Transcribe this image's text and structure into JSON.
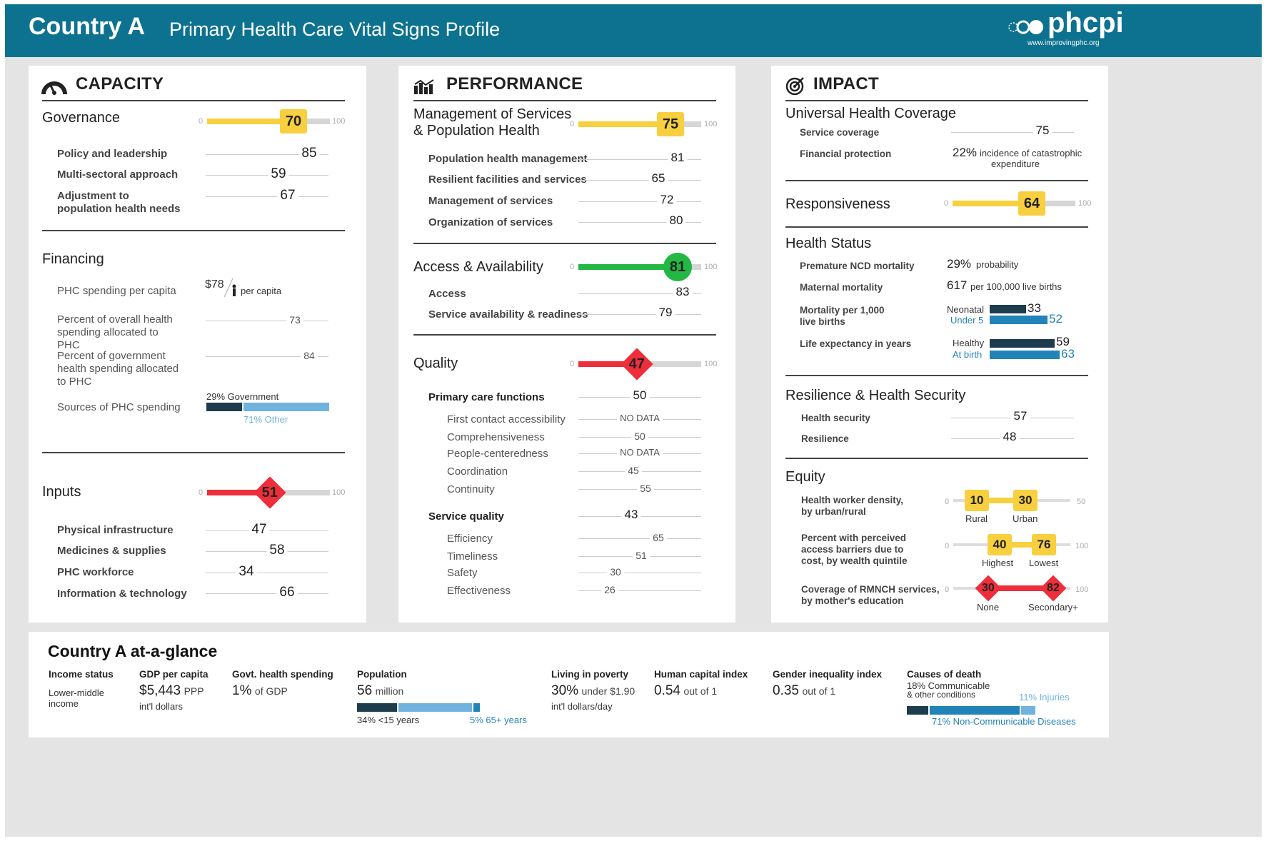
{
  "header": {
    "country": "Country A",
    "subtitle": "Primary Health Care Vital Signs Profile",
    "logo_text": "phcpi",
    "logo_url": "www.improvingphc.org"
  },
  "colors": {
    "header": "#0d7290",
    "yellow": "#f8cf3e",
    "green": "#22b843",
    "red": "#ee2e3a",
    "dark": "#1d3c4e",
    "light_blue": "#6fb3de",
    "mid_blue": "#2283b8",
    "track": "#d6d6d6"
  },
  "capacity": {
    "title": "CAPACITY",
    "icon": "gauge-icon",
    "governance": {
      "label": "Governance",
      "score": "70",
      "value": 70,
      "min": "0",
      "max": "100",
      "items": [
        {
          "label": "Policy and leadership",
          "value": "85"
        },
        {
          "label": "Multi-sectoral approach",
          "value": "59"
        },
        {
          "label": "Adjustment to population health needs",
          "value": "67"
        }
      ]
    },
    "financing": {
      "label": "Financing",
      "spending_label": "PHC spending per capita",
      "spending_value": "$78",
      "spending_unit": "per capita",
      "overall_label": "Percent of overall health spending allocated to PHC",
      "overall_value": "73",
      "gov_label": "Percent of government health spending allocated to PHC",
      "gov_value": "84",
      "sources_label": "Sources of PHC spending",
      "gov_pct": "29%",
      "gov_name": "Government",
      "other_pct": "71%",
      "other_name": "Other",
      "gov_share": 29
    },
    "inputs": {
      "label": "Inputs",
      "score": "51",
      "value": 51,
      "min": "0",
      "max": "100",
      "items": [
        {
          "label": "Physical infrastructure",
          "value": "47"
        },
        {
          "label": "Medicines & supplies",
          "value": "58"
        },
        {
          "label": "PHC workforce",
          "value": "34"
        },
        {
          "label": "Information & technology",
          "value": "66"
        }
      ]
    }
  },
  "performance": {
    "title": "PERFORMANCE",
    "icon": "chart-icon",
    "management": {
      "label1": "Management of Services",
      "label2": "& Population Health",
      "score": "75",
      "value": 75,
      "min": "0",
      "max": "100",
      "items": [
        {
          "label": "Population health management",
          "value": "81"
        },
        {
          "label": "Resilient facilities and services",
          "value": "65"
        },
        {
          "label": "Management of services",
          "value": "72"
        },
        {
          "label": "Organization of services",
          "value": "80"
        }
      ]
    },
    "access": {
      "label": "Access & Availability",
      "score": "81",
      "value": 81,
      "min": "0",
      "max": "100",
      "items": [
        {
          "label": "Access",
          "value": "83"
        },
        {
          "label": "Service availability & readiness",
          "value": "79"
        }
      ]
    },
    "quality": {
      "label": "Quality",
      "score": "47",
      "value": 47,
      "min": "0",
      "max": "100",
      "pcf_label": "Primary care functions",
      "pcf_value": "50",
      "pcf_items": [
        {
          "label": "First contact accessibility",
          "value": "NO DATA"
        },
        {
          "label": "Comprehensiveness",
          "value": "50"
        },
        {
          "label": "People-centeredness",
          "value": "NO DATA"
        },
        {
          "label": "Coordination",
          "value": "45"
        },
        {
          "label": "Continuity",
          "value": "55"
        }
      ],
      "sq_label": "Service quality",
      "sq_value": "43",
      "sq_items": [
        {
          "label": "Efficiency",
          "value": "65"
        },
        {
          "label": "Timeliness",
          "value": "51"
        },
        {
          "label": "Safety",
          "value": "30"
        },
        {
          "label": "Effectiveness",
          "value": "26"
        }
      ]
    }
  },
  "impact": {
    "title": "IMPACT",
    "icon": "target-icon",
    "uhc": {
      "label": "Universal Health Coverage",
      "coverage_label": "Service coverage",
      "coverage_value": "75",
      "fin_label": "Financial protection",
      "fin_pct": "22%",
      "fin_text1": "incidence of catastrophic",
      "fin_text2": "expenditure"
    },
    "responsiveness": {
      "label": "Responsiveness",
      "score": "64",
      "value": 64,
      "min": "0",
      "max": "100"
    },
    "health_status": {
      "label": "Health Status",
      "ncd_label": "Premature NCD mortality",
      "ncd_value": "29%",
      "ncd_unit": "probability",
      "mat_label": "Maternal mortality",
      "mat_value": "617",
      "mat_unit": "per 100,000 live births",
      "mort_label1": "Mortality per 1,000",
      "mort_label2": "live births",
      "neonatal_label": "Neonatal",
      "neonatal_value": "33",
      "neonatal_num": 33,
      "under5_label": "Under 5",
      "under5_value": "52",
      "under5_num": 52,
      "life_label": "Life expectancy in years",
      "healthy_label": "Healthy",
      "healthy_value": "59",
      "healthy_num": 59,
      "birth_label": "At birth",
      "birth_value": "63",
      "birth_num": 63
    },
    "resilience": {
      "label": "Resilience & Health Security",
      "hs_label": "Health security",
      "hs_value": "57",
      "res_label": "Resilience",
      "res_value": "48"
    },
    "equity": {
      "label": "Equity",
      "hw_label1": "Health worker density,",
      "hw_label2": "by urban/rural",
      "hw_min": "0",
      "hw_max": "50",
      "rural_value": "10",
      "rural_num": 10,
      "rural_label": "Rural",
      "urban_value": "30",
      "urban_num": 30,
      "urban_label": "Urban",
      "pb_label1": "Percent with perceived",
      "pb_label2": "access barriers due to",
      "pb_label3": "cost, by wealth quintile",
      "pb_min": "0",
      "pb_max": "100",
      "highest_value": "40",
      "highest_num": 40,
      "highest_label": "Highest",
      "lowest_value": "76",
      "lowest_num": 76,
      "lowest_label": "Lowest",
      "rm_label1": "Coverage of RMNCH services,",
      "rm_label2": "by mother's education",
      "rm_min": "0",
      "rm_max": "100",
      "none_value": "30",
      "none_num": 30,
      "none_label": "None",
      "sec_value": "82",
      "sec_num": 82,
      "sec_label": "Secondary+"
    }
  },
  "glance": {
    "title": "Country A at-a-glance",
    "income": {
      "h": "Income status",
      "v1": "Lower-middle",
      "v2": "income"
    },
    "gdp": {
      "h": "GDP per capita",
      "v": "$5,443",
      "unit": "PPP",
      "sub": "int'l dollars"
    },
    "govt": {
      "h": "Govt. health spending",
      "v": "1%",
      "unit": "of GDP"
    },
    "population": {
      "h": "Population",
      "v": "56",
      "unit": "million",
      "young_pct": "34%",
      "young_label": "<15 years",
      "old_pct": "5%",
      "old_label": "65+ years",
      "young": 34,
      "old": 5
    },
    "poverty": {
      "h": "Living in poverty",
      "v": "30%",
      "unit": "under $1.90",
      "sub": "int'l dollars/day"
    },
    "hci": {
      "h": "Human capital index",
      "v": "0.54",
      "unit": "out of 1"
    },
    "gii": {
      "h": "Gender inequality index",
      "v": "0.35",
      "unit": "out of 1"
    },
    "causes": {
      "h": "Causes of death",
      "comm_pct": "18%",
      "comm_label1": "Communicable",
      "comm_label2": "& other conditions",
      "inj_pct": "11%",
      "inj_label": "Injuries",
      "ncd_pct": "71%",
      "ncd_label": "Non-Communicable Diseases",
      "comm": 18,
      "ncd": 71,
      "inj": 11
    }
  }
}
